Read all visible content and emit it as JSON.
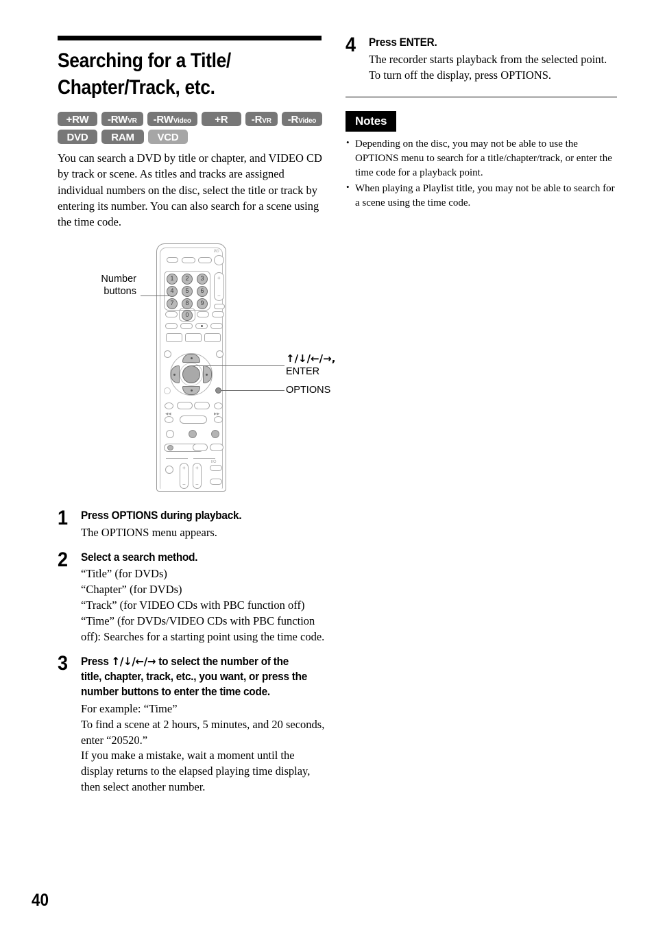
{
  "document": {
    "page_number": "40",
    "title_line1": "Searching for a Title/",
    "title_line2": "Chapter/Track, etc."
  },
  "disc_badges": {
    "row1": [
      {
        "main": "+RW",
        "sub": "",
        "shade": "dark"
      },
      {
        "main": "-RW",
        "sub": "VR",
        "shade": "dark"
      },
      {
        "main": "-RW",
        "sub": "Video",
        "shade": "dark"
      },
      {
        "main": "+R",
        "sub": "",
        "shade": "dark"
      },
      {
        "main": "-R",
        "sub": "VR",
        "shade": "dark"
      },
      {
        "main": "-R",
        "sub": "Video",
        "shade": "dark"
      }
    ],
    "row2": [
      {
        "main": "DVD",
        "sub": "",
        "shade": "dark"
      },
      {
        "main": "RAM",
        "sub": "",
        "shade": "dark"
      },
      {
        "main": "VCD",
        "sub": "",
        "shade": "light"
      }
    ],
    "colors": {
      "dark": "#777777",
      "light": "#a6a6a6",
      "text": "#ffffff"
    }
  },
  "intro": {
    "paragraph": "You can search a DVD by title or chapter, and VIDEO CD by track or scene. As titles and tracks are assigned individual numbers on the disc, select the title or track by entering its number. You can also search for a scene using the time code."
  },
  "figure": {
    "callout_number_buttons": "Number\nbuttons",
    "callout_enter_arrows": "↑/↓/←/→,",
    "callout_enter_label": "ENTER",
    "callout_options": "OPTIONS",
    "number_keys": [
      "1",
      "2",
      "3",
      "4",
      "5",
      "6",
      "7",
      "8",
      "9",
      "0"
    ],
    "power_symbol": "I/⏻"
  },
  "steps": [
    {
      "number": "1",
      "heading": "Press OPTIONS during playback.",
      "text": "The OPTIONS menu appears."
    },
    {
      "number": "2",
      "heading": "Select a search method.",
      "text": "“Title” (for DVDs)\n“Chapter” (for DVDs)\n“Track” (for VIDEO CDs with PBC function off)\n“Time” (for DVDs/VIDEO CDs with PBC function off): Searches for a starting point using the time code."
    },
    {
      "number": "3",
      "heading_pre": "Press ",
      "heading_arrows": "↑/↓/←/→",
      "heading_post": " to select the number of the title, chapter, track, etc., you want, or press the number buttons to enter the time code.",
      "text": "For example: “Time”\nTo find a scene at 2 hours, 5 minutes, and 20 seconds, enter “20520.”\nIf you make a mistake, wait a moment until the display returns to the elapsed playing time display, then select another number."
    },
    {
      "number": "4",
      "heading": "Press ENTER.",
      "text": "The recorder starts playback from the selected point.\nTo turn off the display, press OPTIONS."
    }
  ],
  "notes": {
    "header": "Notes",
    "items": [
      "Depending on the disc, you may not be able to use the OPTIONS menu to search for a title/chapter/track, or enter the time code for a playback point.",
      "When playing a Playlist title, you may not be able to search for a scene using the time code."
    ]
  }
}
